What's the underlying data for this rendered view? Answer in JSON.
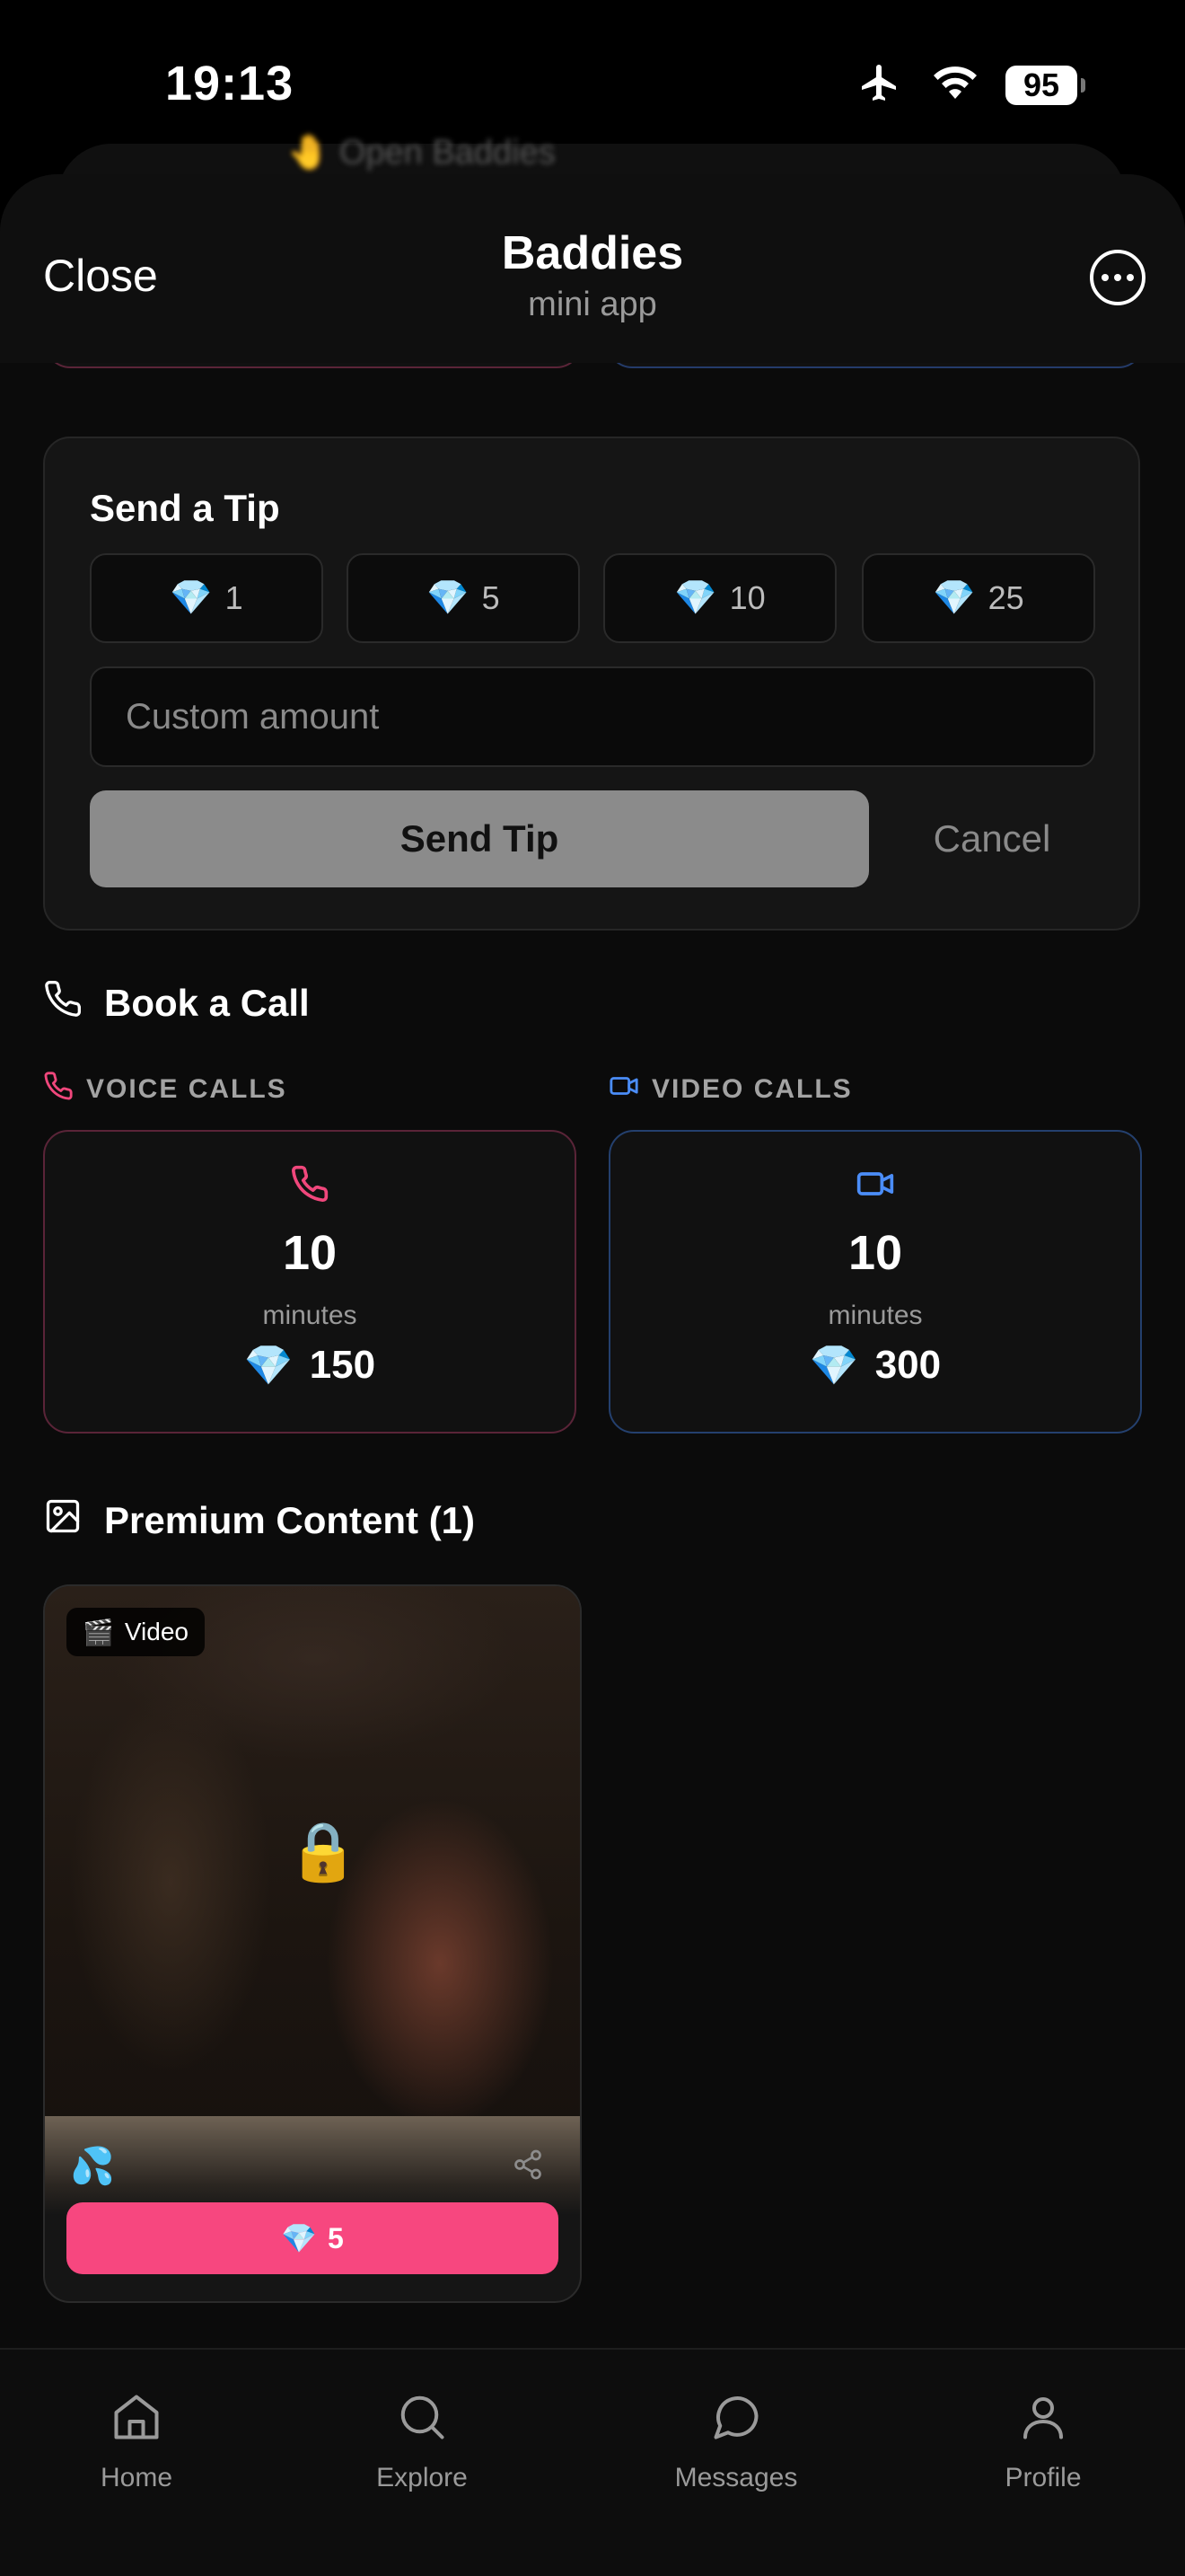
{
  "status_bar": {
    "time": "19:13",
    "battery": "95",
    "icons": [
      "airplane-icon",
      "wifi-icon",
      "battery-icon"
    ]
  },
  "background_peek": {
    "text": "🤚 Open Baddies"
  },
  "header": {
    "close_label": "Close",
    "title": "Baddies",
    "subtitle": "mini app",
    "more_icon": "more-icon"
  },
  "tip": {
    "title": "Send a Tip",
    "amounts": [
      "1",
      "5",
      "10",
      "25"
    ],
    "gem": "💎",
    "custom_placeholder": "Custom amount",
    "send_label": "Send Tip",
    "cancel_label": "Cancel"
  },
  "calls": {
    "title": "Book a Call",
    "voice": {
      "heading": "VOICE CALLS",
      "minutes": "10",
      "unit": "minutes",
      "price": "150",
      "color": "#f0477c"
    },
    "video": {
      "heading": "VIDEO CALLS",
      "minutes": "10",
      "unit": "minutes",
      "price": "300",
      "color": "#4b8df8"
    }
  },
  "premium": {
    "title": "Premium Content (1)",
    "items": [
      {
        "type_emoji": "🎬",
        "type_label": "Video",
        "lock": "🔒",
        "drops": "💦",
        "price": "5",
        "button_color": "#f7477f"
      }
    ]
  },
  "nav": [
    {
      "label": "Home",
      "icon": "home-icon"
    },
    {
      "label": "Explore",
      "icon": "search-icon"
    },
    {
      "label": "Messages",
      "icon": "chat-icon"
    },
    {
      "label": "Profile",
      "icon": "profile-icon"
    }
  ]
}
